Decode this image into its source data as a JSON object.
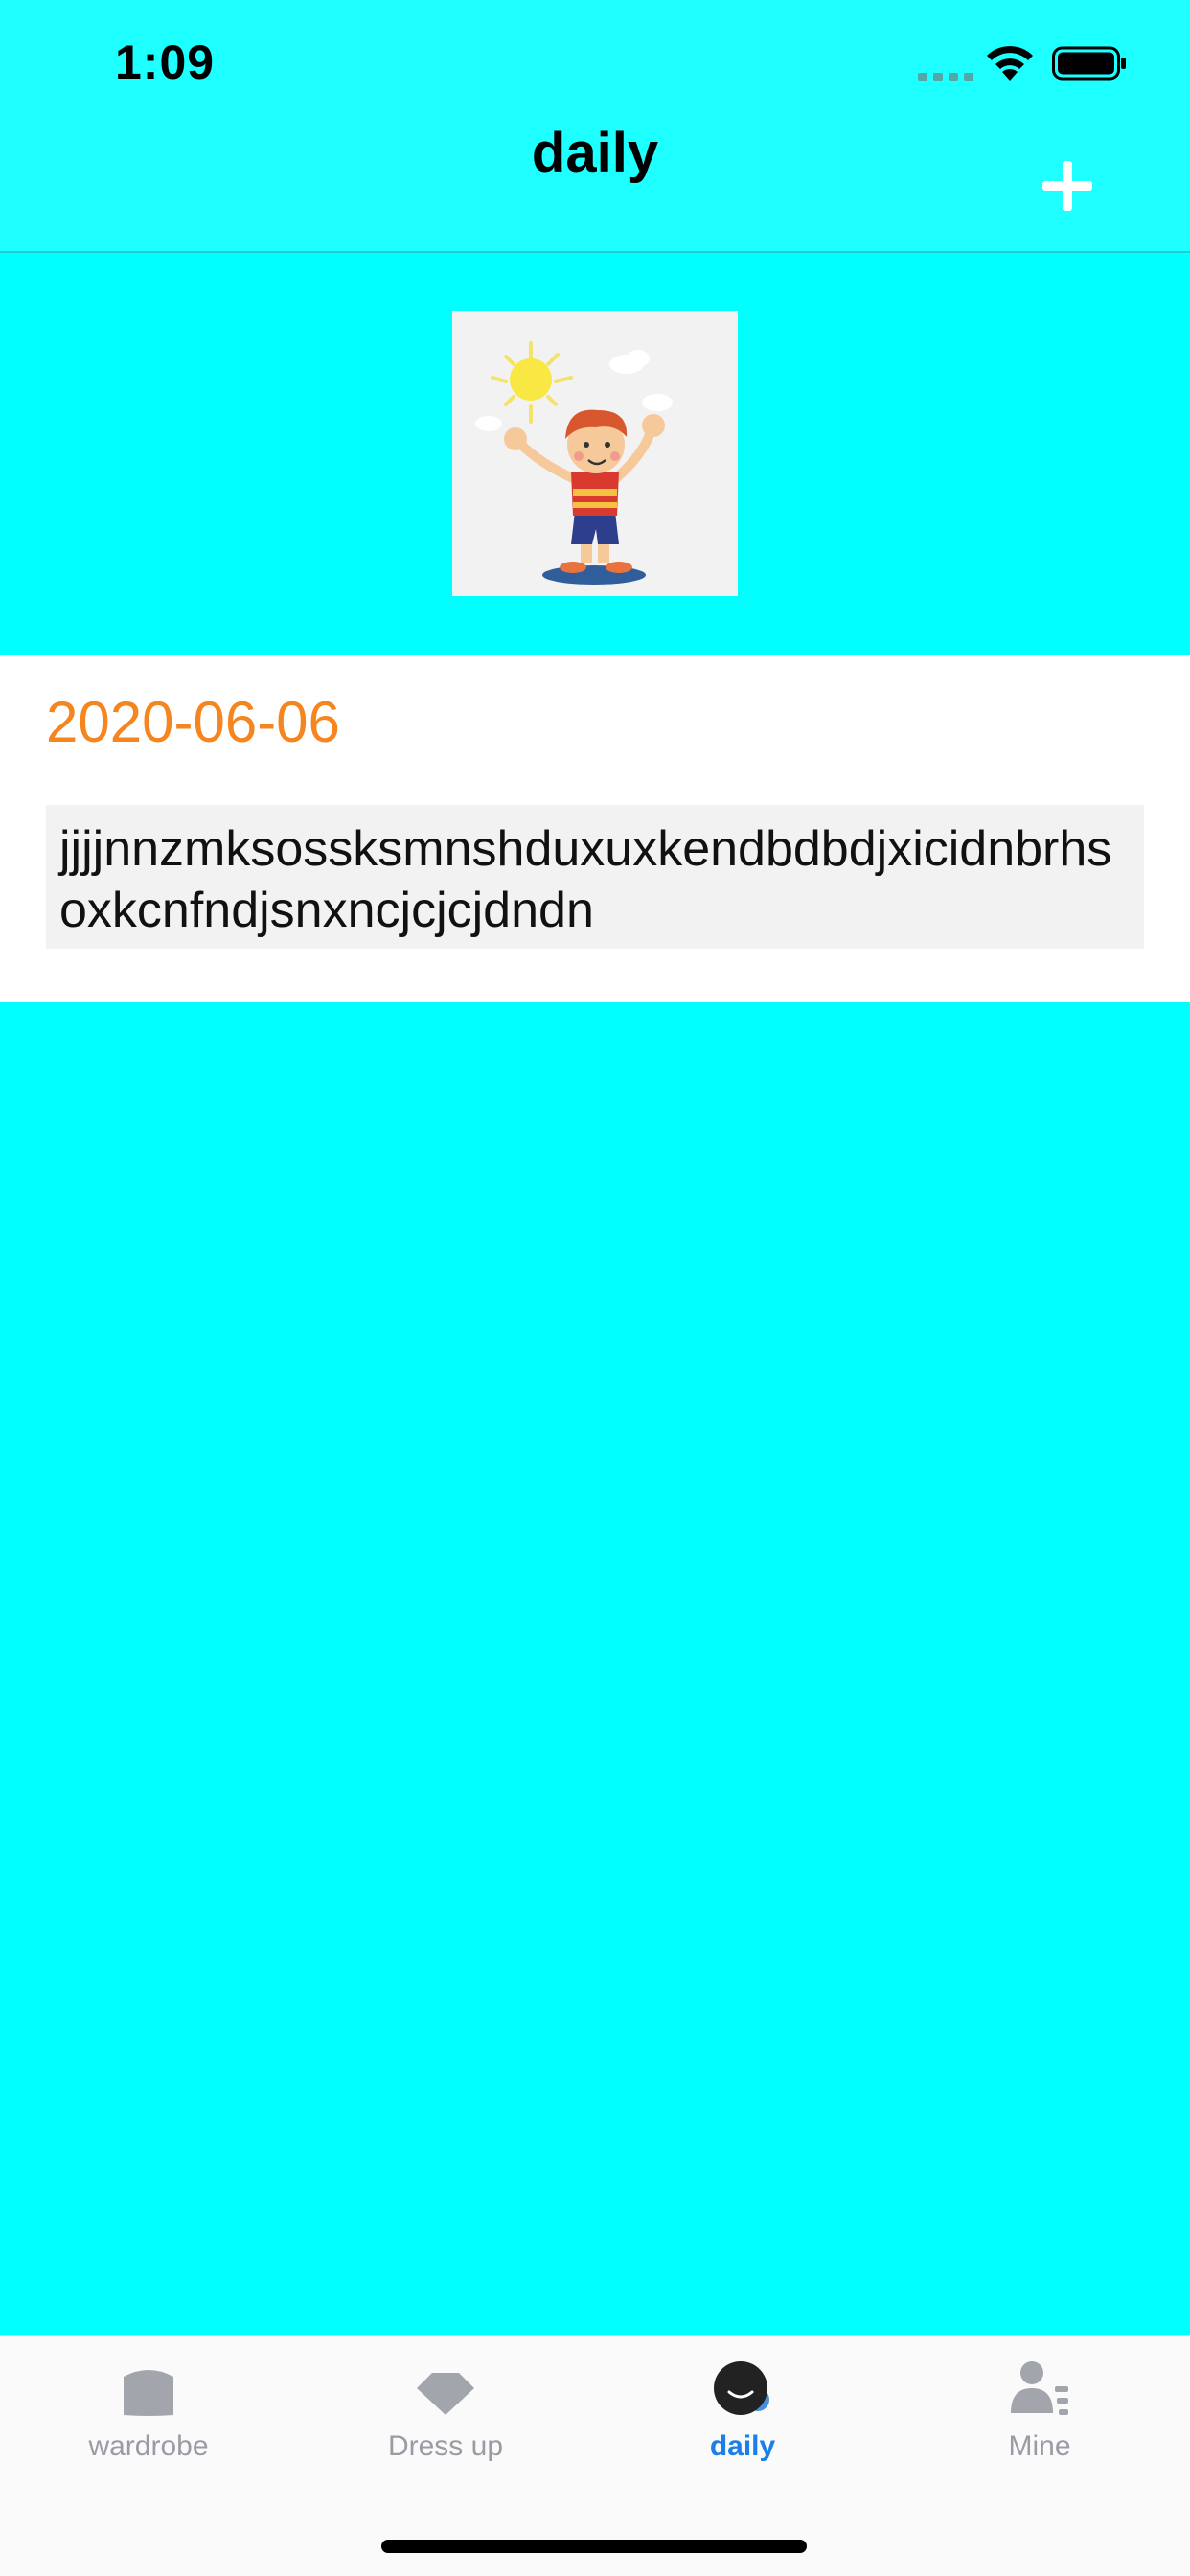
{
  "status_bar": {
    "time": "1:09"
  },
  "nav": {
    "title": "daily",
    "add_icon": "plus-icon"
  },
  "entry": {
    "date": "2020-06-06",
    "note": "jjjjnnzmksossksmnshduxuxkendbdbdjxicidnbrhsoxkcnfndjsnxncjcjcjdndn"
  },
  "tabs": [
    {
      "label": "wardrobe",
      "icon": "wardrobe-icon",
      "active": false
    },
    {
      "label": "Dress up",
      "icon": "diamond-icon",
      "active": false
    },
    {
      "label": "daily",
      "icon": "smile-icon",
      "active": true
    },
    {
      "label": "Mine",
      "icon": "profile-icon",
      "active": false
    }
  ],
  "colors": {
    "background": "#00FFFF",
    "header": "#1EFFFF",
    "date_accent": "#F5851F",
    "tab_active": "#1A7FE8",
    "tab_inactive": "#9A9CA3"
  }
}
